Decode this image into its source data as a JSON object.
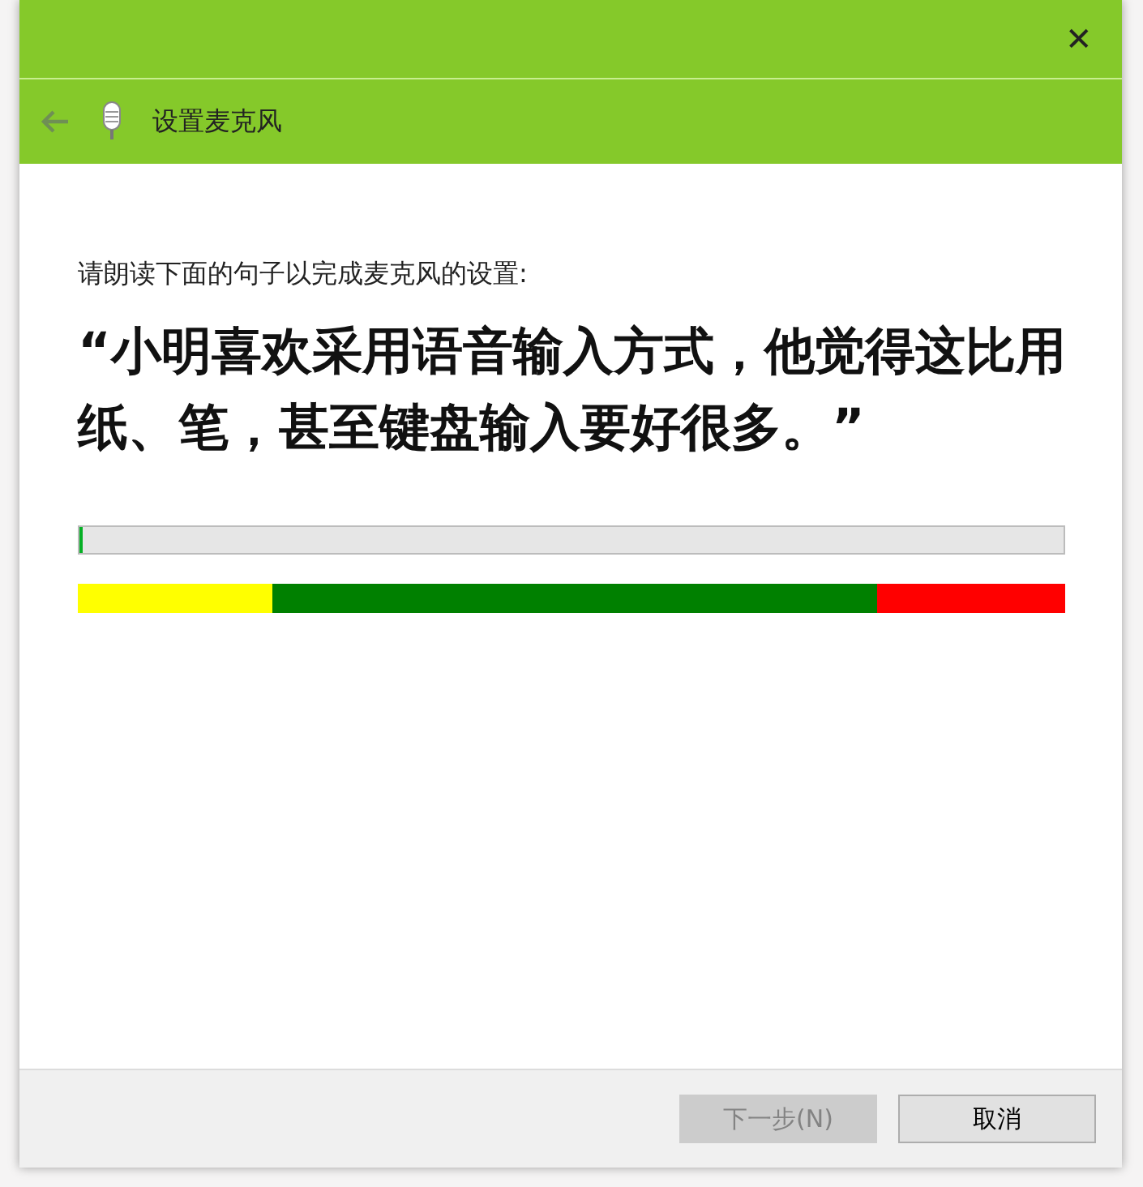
{
  "window": {
    "title": "设置麦克风",
    "close": "✕"
  },
  "instruction": "请朗读下面的句子以完成麦克风的设置:",
  "sentence": "“小明喜欢采用语音输入方式，他觉得这比用纸、笔，甚至键盘输入要好很多。”",
  "meter": {
    "level": 0.003
  },
  "zones": [
    {
      "color": "#ffff00"
    },
    {
      "color": "#008000"
    },
    {
      "color": "#ff0000"
    }
  ],
  "buttons": [
    {
      "label": "下一步(N)",
      "disabled": true
    },
    {
      "label": "取消",
      "disabled": false
    }
  ]
}
